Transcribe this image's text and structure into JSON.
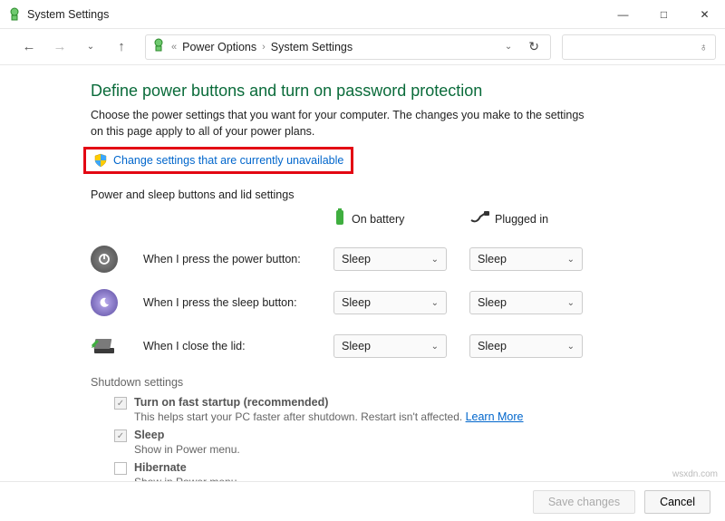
{
  "window": {
    "title": "System Settings"
  },
  "breadcrumb": {
    "level1": "Power Options",
    "level2": "System Settings"
  },
  "page": {
    "heading": "Define power buttons and turn on password protection",
    "subtext": "Choose the power settings that you want for your computer. The changes you make to the settings on this page apply to all of your power plans.",
    "change_link": "Change settings that are currently unavailable",
    "buttons_section": "Power and sleep buttons and lid settings",
    "col_battery": "On battery",
    "col_plugged": "Plugged in",
    "rows": {
      "power": {
        "label": "When I press the power button:",
        "battery": "Sleep",
        "plugged": "Sleep"
      },
      "sleep": {
        "label": "When I press the sleep button:",
        "battery": "Sleep",
        "plugged": "Sleep"
      },
      "lid": {
        "label": "When I close the lid:",
        "battery": "Sleep",
        "plugged": "Sleep"
      }
    },
    "shutdown_section": "Shutdown settings",
    "shutdown": {
      "fast": {
        "title": "Turn on fast startup (recommended)",
        "sub": "This helps start your PC faster after shutdown. Restart isn't affected. ",
        "learn": "Learn More"
      },
      "sleep": {
        "title": "Sleep",
        "sub": "Show in Power menu."
      },
      "hibernate": {
        "title": "Hibernate",
        "sub": "Show in Power menu."
      }
    }
  },
  "footer": {
    "save": "Save changes",
    "cancel": "Cancel"
  },
  "watermark": "wsxdn.com"
}
